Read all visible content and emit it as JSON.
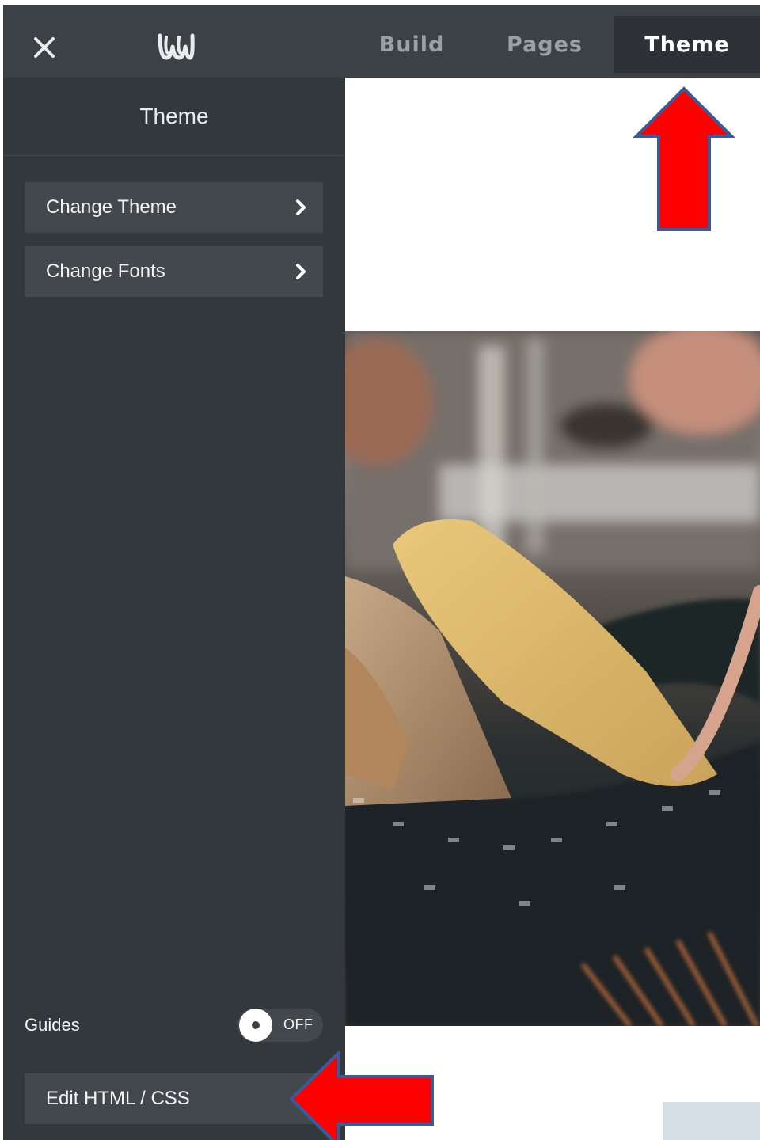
{
  "topbar": {
    "close_icon": "close-icon",
    "logo_icon": "weebly-logo-icon",
    "tabs": [
      {
        "label": "Build",
        "active": false
      },
      {
        "label": "Pages",
        "active": false
      },
      {
        "label": "Theme",
        "active": true
      }
    ]
  },
  "sidebar": {
    "title": "Theme",
    "items": [
      {
        "label": "Change Theme",
        "icon": "chevron-right-icon"
      },
      {
        "label": "Change Fonts",
        "icon": "chevron-right-icon"
      }
    ],
    "guides": {
      "label": "Guides",
      "state": "OFF",
      "on": false
    },
    "edit_html_css": {
      "label": "Edit HTML / CSS"
    }
  },
  "preview": {
    "hero_image": "bread-basket-photo"
  },
  "annotations": {
    "arrow_color": "#ff0000",
    "arrow_outline": "#3a5a99"
  },
  "colors": {
    "topbar_bg": "#3c4146",
    "sidebar_bg": "#33383c",
    "button_bg": "#43484d",
    "active_tab_bg": "#2e3236"
  }
}
